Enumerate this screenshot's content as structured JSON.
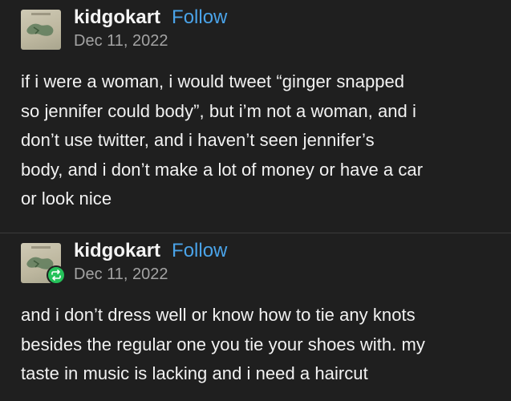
{
  "posts": [
    {
      "username": "kidgokart",
      "follow_label": "Follow",
      "date": "Dec 11, 2022",
      "avatar_icon": "album-cover-avatar",
      "reblog": false,
      "lines": [
        "if i were a woman, i would tweet “ginger snapped",
        "so jennifer could body”, but i’m not a woman, and i",
        "don’t use twitter, and i haven’t seen jennifer’s",
        "body, and i don’t make a lot of money or have a car",
        "or look nice"
      ]
    },
    {
      "username": "kidgokart",
      "follow_label": "Follow",
      "date": "Dec 11, 2022",
      "avatar_icon": "album-cover-avatar",
      "reblog": true,
      "reblog_icon": "reblog-icon",
      "lines": [
        "and i don’t dress well or know how to tie any knots",
        "besides the regular one you tie your shoes with. my",
        "taste in music is lacking and i need a haircut"
      ]
    }
  ],
  "colors": {
    "background": "#1f1f1f",
    "follow": "#4aa3e8",
    "reblog_badge": "#25c25a"
  }
}
